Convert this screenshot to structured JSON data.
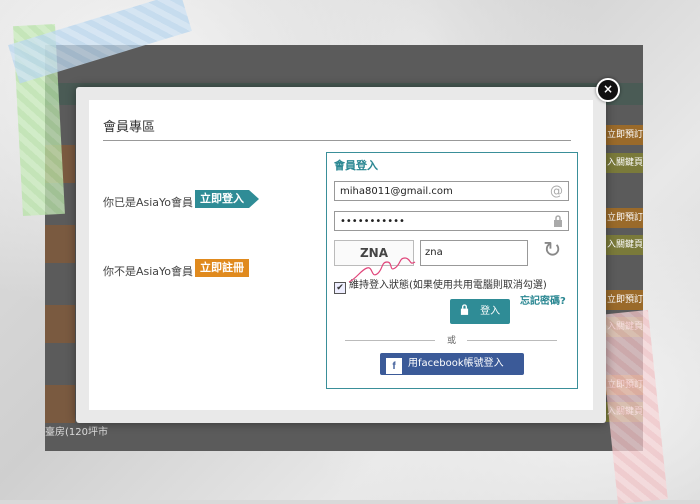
{
  "modal": {
    "title": "會員專區",
    "close": "×"
  },
  "member": {
    "label": "你已是AsiaYo會員",
    "tag": "立即登入"
  },
  "nonmember": {
    "label": "你不是AsiaYo會員",
    "tag": "立即註冊"
  },
  "login": {
    "title": "會員登入",
    "email_value": "miha8011@gmail.com",
    "password_value": "•••••••••••",
    "captcha_text": "ZNA",
    "captcha_input": "zna",
    "remember_label": "維持登入狀態(如果使用共用電腦則取消勾選)",
    "remember_checked": true,
    "submit_label": "登入",
    "forgot_label": "忘記密碼?",
    "or_label": "或",
    "facebook_label": "用facebook帳號登入"
  },
  "background": {
    "caption": "臺房(120坪市",
    "btn_booking": "立即預訂",
    "btn_more": "入關鍵頁"
  },
  "colors": {
    "accent": "#2f8c96",
    "register": "#e08a1e",
    "facebook": "#3b5a98"
  }
}
